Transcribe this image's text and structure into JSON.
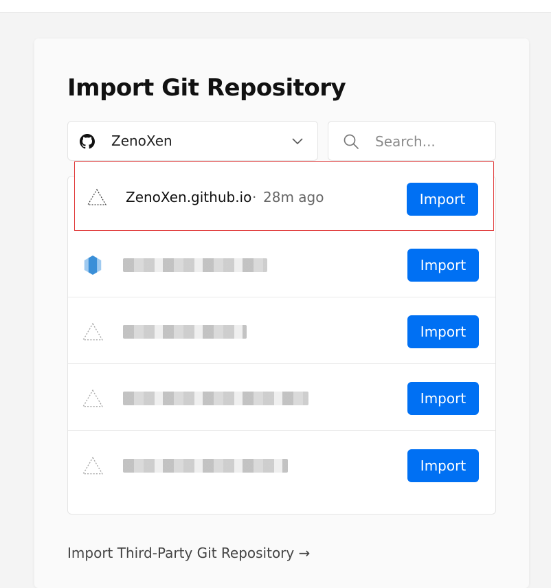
{
  "page": {
    "title": "Import Git Repository",
    "third_party_link": "Import Third-Party Git Repository →"
  },
  "account_select": {
    "icon": "github-icon",
    "value": "ZenoXen",
    "chevron": "chevron-down-icon"
  },
  "search": {
    "icon": "search-icon",
    "placeholder": "Search...",
    "value": ""
  },
  "repositories": [
    {
      "name": "ZenoXen.github.io",
      "separator": "·",
      "updated": "28m ago",
      "icon": "vercel-triangle-icon",
      "import_label": "Import",
      "highlighted": true,
      "redacted": false
    },
    {
      "name": "",
      "separator": "",
      "updated": "",
      "icon": "framework-icon",
      "import_label": "Import",
      "highlighted": false,
      "redacted": true
    },
    {
      "name": "",
      "separator": "",
      "updated": "",
      "icon": "vercel-triangle-icon",
      "import_label": "Import",
      "highlighted": false,
      "redacted": true
    },
    {
      "name": "",
      "separator": "",
      "updated": "",
      "icon": "vercel-triangle-icon",
      "import_label": "Import",
      "highlighted": false,
      "redacted": true
    },
    {
      "name": "",
      "separator": "",
      "updated": "",
      "icon": "vercel-triangle-icon",
      "import_label": "Import",
      "highlighted": false,
      "redacted": true
    }
  ],
  "colors": {
    "accent": "#0070f3",
    "highlight_border": "#e03a3a",
    "background": "#f4f4f4",
    "card": "#fafafa"
  }
}
